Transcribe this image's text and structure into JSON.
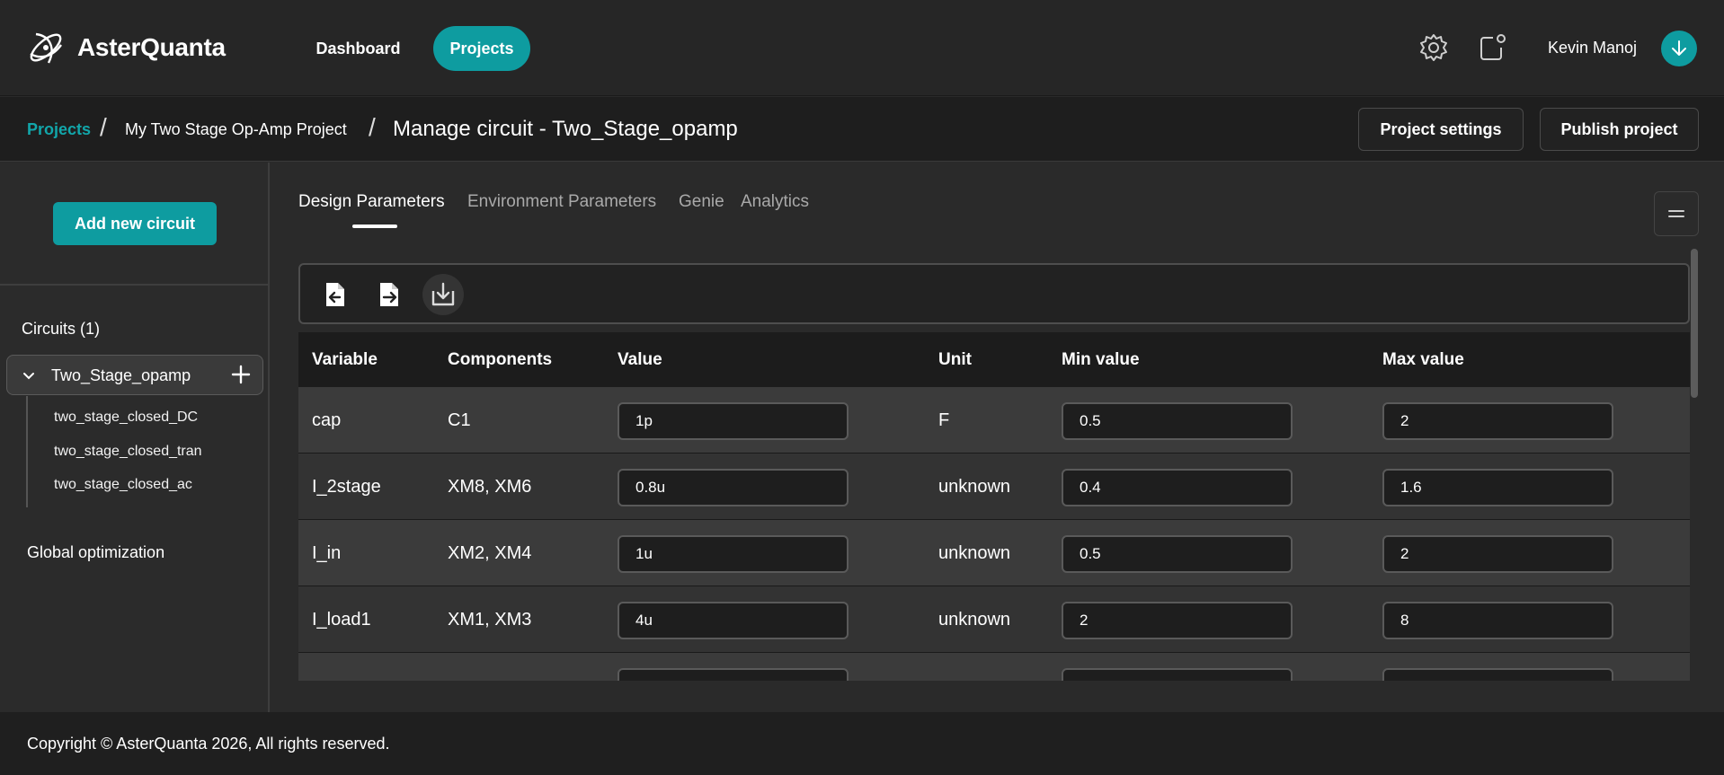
{
  "app": {
    "name": "AsterQuanta"
  },
  "nav": {
    "dashboard": "Dashboard",
    "projects": "Projects"
  },
  "user": {
    "name": "Kevin Manoj"
  },
  "breadcrumb": {
    "root": "Projects",
    "separator": "/",
    "project": "My Two Stage Op-Amp Project",
    "current": "Manage circuit - Two_Stage_opamp"
  },
  "header_actions": {
    "project_settings": "Project settings",
    "publish_project": "Publish project"
  },
  "sidebar": {
    "add_circuit": "Add new circuit",
    "circuits_title": "Circuits (1)",
    "circuit": {
      "name": "Two_Stage_opamp",
      "children": [
        "two_stage_closed_DC",
        "two_stage_closed_tran",
        "two_stage_closed_ac"
      ]
    },
    "global_optimization": "Global optimization"
  },
  "tabs": [
    "Design Parameters",
    "Environment Parameters",
    "Genie",
    "Analytics"
  ],
  "active_tab": "Design Parameters",
  "toolbar_icons": [
    "file-import-icon",
    "file-export-icon",
    "download-icon"
  ],
  "table": {
    "columns": [
      "Variable",
      "Components",
      "Value",
      "Unit",
      "Min value",
      "Max value"
    ],
    "rows": [
      {
        "variable": "cap",
        "components": "C1",
        "value": "1p",
        "unit": "F",
        "min": "0.5",
        "max": "2"
      },
      {
        "variable": "I_2stage",
        "components": "XM8, XM6",
        "value": "0.8u",
        "unit": "unknown",
        "min": "0.4",
        "max": "1.6"
      },
      {
        "variable": "I_in",
        "components": "XM2, XM4",
        "value": "1u",
        "unit": "unknown",
        "min": "0.5",
        "max": "2"
      },
      {
        "variable": "I_load1",
        "components": "XM1, XM3",
        "value": "4u",
        "unit": "unknown",
        "min": "2",
        "max": "8"
      },
      {
        "variable": "",
        "components": "",
        "value": "",
        "unit": "",
        "min": "",
        "max": ""
      }
    ]
  },
  "footer": {
    "copyright": "Copyright © AsterQuanta 2026, All rights reserved."
  },
  "colors": {
    "accent": "#0e9ca0",
    "background": "#2a2a2a",
    "header": "#262626"
  }
}
